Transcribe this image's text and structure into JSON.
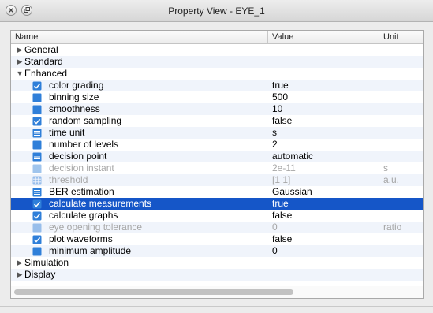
{
  "window": {
    "title": "Property View - EYE_1"
  },
  "columns": {
    "name": "Name",
    "value": "Value",
    "unit": "Unit"
  },
  "colors": {
    "selection": "#1556c8",
    "icon_blue": "#2f7fd9",
    "disabled_text": "#a6a6a6"
  },
  "rows": [
    {
      "type": "group",
      "label": "General",
      "expanded": false
    },
    {
      "type": "group",
      "label": "Standard",
      "expanded": false
    },
    {
      "type": "group",
      "label": "Enhanced",
      "expanded": true
    },
    {
      "type": "prop",
      "icon": "checkbox-icon",
      "name": "color grading",
      "value": "true",
      "unit": ""
    },
    {
      "type": "prop",
      "icon": "number-field-icon",
      "name": "binning size",
      "value": "500",
      "unit": ""
    },
    {
      "type": "prop",
      "icon": "number-field-icon",
      "name": "smoothness",
      "value": "10",
      "unit": ""
    },
    {
      "type": "prop",
      "icon": "checkbox-icon",
      "name": "random sampling",
      "value": "false",
      "unit": ""
    },
    {
      "type": "prop",
      "icon": "list-icon",
      "name": "time unit",
      "value": "s",
      "unit": ""
    },
    {
      "type": "prop",
      "icon": "number-field-icon",
      "name": "number of levels",
      "value": "2",
      "unit": ""
    },
    {
      "type": "prop",
      "icon": "list-icon",
      "name": "decision point",
      "value": "automatic",
      "unit": ""
    },
    {
      "type": "prop",
      "icon": "number-field-icon",
      "name": "decision instant",
      "value": "2e-11",
      "unit": "s",
      "disabled": true
    },
    {
      "type": "prop",
      "icon": "grid-icon",
      "name": "threshold",
      "value": "[1 1]",
      "unit": "a.u.",
      "disabled": true
    },
    {
      "type": "prop",
      "icon": "list-icon",
      "name": "BER estimation",
      "value": "Gaussian",
      "unit": ""
    },
    {
      "type": "prop",
      "icon": "checkbox-icon",
      "name": "calculate measurements",
      "value": "true",
      "unit": "",
      "selected": true
    },
    {
      "type": "prop",
      "icon": "checkbox-icon",
      "name": "calculate graphs",
      "value": "false",
      "unit": ""
    },
    {
      "type": "prop",
      "icon": "number-field-icon",
      "name": "eye opening tolerance",
      "value": "0",
      "unit": "ratio",
      "disabled": true
    },
    {
      "type": "prop",
      "icon": "checkbox-icon",
      "name": "plot waveforms",
      "value": "false",
      "unit": ""
    },
    {
      "type": "prop",
      "icon": "number-field-icon",
      "name": "minimum amplitude",
      "value": "0",
      "unit": ""
    },
    {
      "type": "group",
      "label": "Simulation",
      "expanded": false
    },
    {
      "type": "group",
      "label": "Display",
      "expanded": false
    }
  ]
}
